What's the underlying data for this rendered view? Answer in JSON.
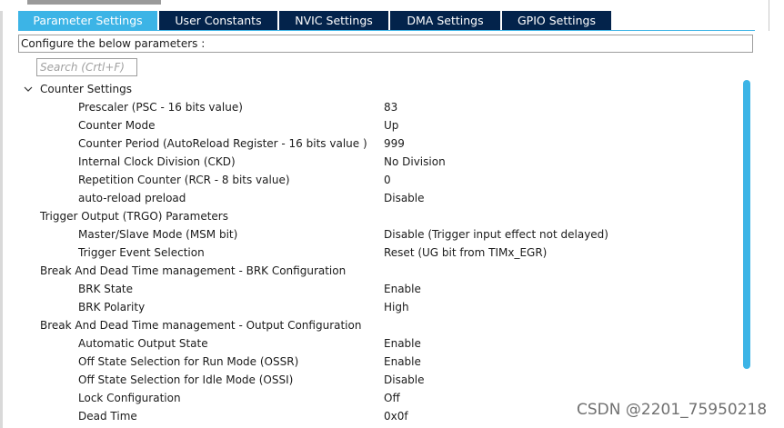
{
  "tabs": [
    {
      "label": "Parameter Settings",
      "active": true
    },
    {
      "label": "User Constants",
      "active": false
    },
    {
      "label": "NVIC Settings",
      "active": false
    },
    {
      "label": "DMA Settings",
      "active": false
    },
    {
      "label": "GPIO Settings",
      "active": false
    }
  ],
  "config_header": "Configure the below parameters :",
  "search": {
    "placeholder": "Search (Crtl+F)"
  },
  "categories": [
    {
      "title": "Counter Settings",
      "expanded": true,
      "params": [
        {
          "label": "Prescaler (PSC - 16 bits value)",
          "value": "83"
        },
        {
          "label": "Counter Mode",
          "value": "Up"
        },
        {
          "label": "Counter Period (AutoReload Register - 16 bits value )",
          "value": "999"
        },
        {
          "label": "Internal Clock Division (CKD)",
          "value": "No Division"
        },
        {
          "label": "Repetition Counter (RCR - 8 bits value)",
          "value": "0"
        },
        {
          "label": "auto-reload preload",
          "value": "Disable"
        }
      ]
    },
    {
      "title": "Trigger Output (TRGO) Parameters",
      "expanded": true,
      "params": [
        {
          "label": "Master/Slave Mode (MSM bit)",
          "value": "Disable (Trigger input effect not delayed)"
        },
        {
          "label": "Trigger Event Selection",
          "value": "Reset (UG bit from TIMx_EGR)"
        }
      ]
    },
    {
      "title": "Break And Dead Time management - BRK Configuration",
      "expanded": true,
      "params": [
        {
          "label": "BRK State",
          "value": "Enable"
        },
        {
          "label": "BRK Polarity",
          "value": "High"
        }
      ]
    },
    {
      "title": "Break And Dead Time management - Output Configuration",
      "expanded": true,
      "params": [
        {
          "label": "Automatic Output State",
          "value": "Enable"
        },
        {
          "label": "Off State Selection for Run Mode (OSSR)",
          "value": "Enable"
        },
        {
          "label": "Off State Selection for Idle Mode (OSSI)",
          "value": "Disable"
        },
        {
          "label": "Lock Configuration",
          "value": "Off"
        },
        {
          "label": "Dead Time",
          "value": "0x0f"
        }
      ]
    }
  ],
  "watermark": "CSDN @2201_75950218",
  "colors": {
    "tab_active": "#3cb4e6",
    "tab_inactive": "#03234b",
    "scrollbar": "#3cb4e6"
  }
}
